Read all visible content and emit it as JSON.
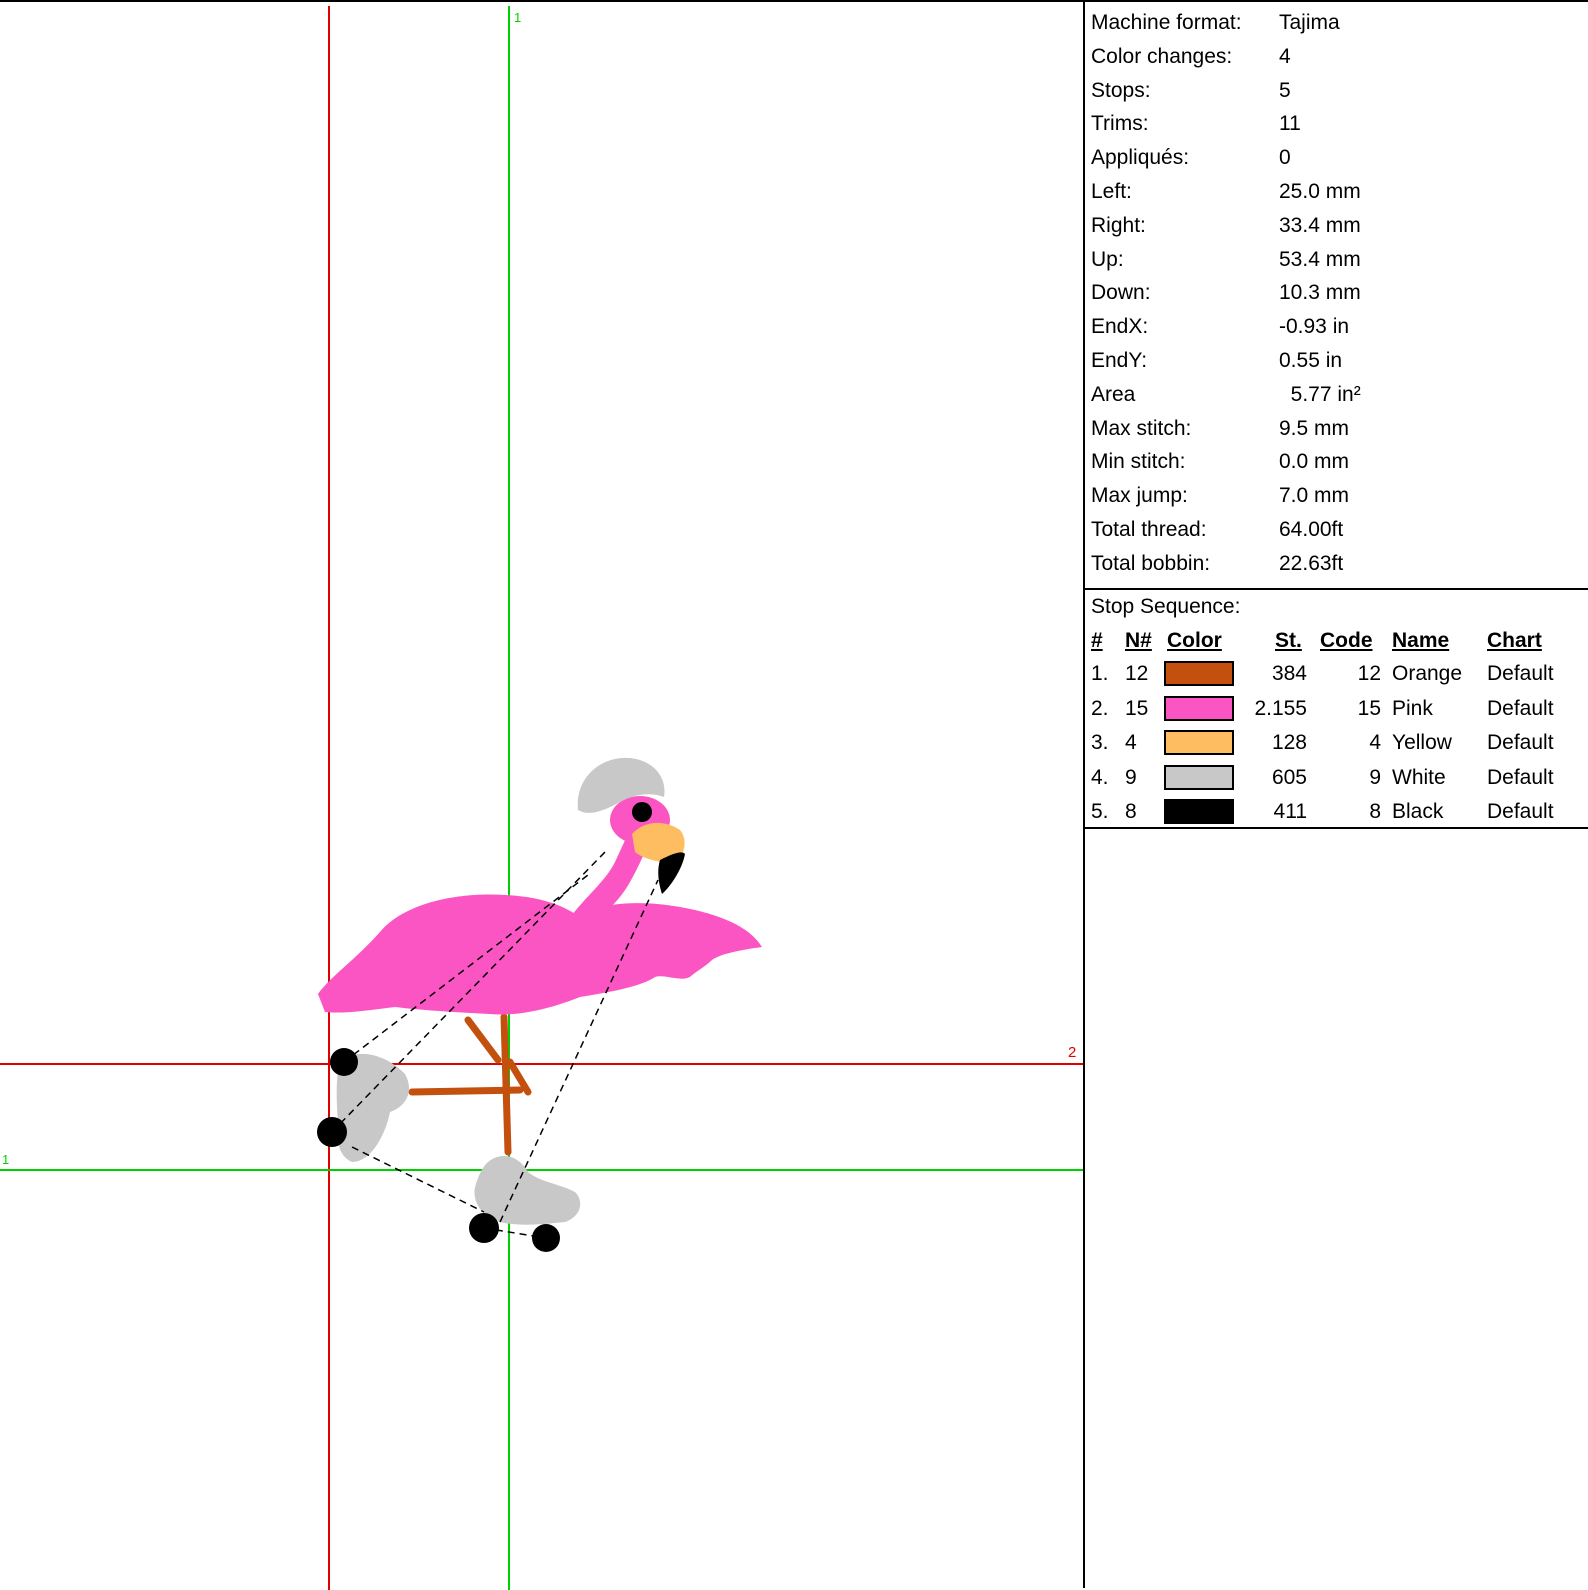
{
  "stats": [
    {
      "label": "Machine format:",
      "value": "Tajima"
    },
    {
      "label": "Color changes:",
      "value": "4"
    },
    {
      "label": "Stops:",
      "value": "5"
    },
    {
      "label": "Trims:",
      "value": "11"
    },
    {
      "label": "Appliqués:",
      "value": "0"
    },
    {
      "label": "Left:",
      "value": "25.0 mm"
    },
    {
      "label": "Right:",
      "value": "33.4 mm"
    },
    {
      "label": "Up:",
      "value": "53.4 mm"
    },
    {
      "label": "Down:",
      "value": "10.3 mm"
    },
    {
      "label": "EndX:",
      "value": "-0.93 in"
    },
    {
      "label": "EndY:",
      "value": "0.55 in"
    },
    {
      "label": "Area",
      "value": "  5.77 in²"
    },
    {
      "label": "Max stitch:",
      "value": "9.5 mm"
    },
    {
      "label": "Min stitch:",
      "value": "0.0 mm"
    },
    {
      "label": "Max jump:",
      "value": "7.0 mm"
    },
    {
      "label": "Total thread:",
      "value": "64.00ft"
    },
    {
      "label": "Total bobbin:",
      "value": "22.63ft"
    }
  ],
  "stop_sequence": {
    "title": "Stop Sequence:",
    "headers": {
      "num": "#",
      "needle": "N#",
      "color": "Color",
      "stitches": "St.",
      "code": "Code",
      "name": "Name",
      "chart": "Chart"
    },
    "rows": [
      {
        "num": "1.",
        "needle": "12",
        "color": "#c4500e",
        "stitches": "384",
        "code": "12",
        "name": "Orange",
        "chart": "Default"
      },
      {
        "num": "2.",
        "needle": "15",
        "color": "#fb55c3",
        "stitches": "2.155",
        "code": "15",
        "name": "Pink",
        "chart": "Default"
      },
      {
        "num": "3.",
        "needle": "4",
        "color": "#fdbd60",
        "stitches": "128",
        "code": "4",
        "name": "Yellow",
        "chart": "Default"
      },
      {
        "num": "4.",
        "needle": "9",
        "color": "#c8c8c8",
        "stitches": "605",
        "code": "9",
        "name": "White",
        "chart": "Default"
      },
      {
        "num": "5.",
        "needle": "8",
        "color": "#000000",
        "stitches": "411",
        "code": "8",
        "name": "Black",
        "chart": "Default"
      }
    ]
  },
  "guides": {
    "vertical_green_label": "1",
    "horizontal_green_label": "1",
    "horizontal_red_label": "2",
    "red_color": "#e00000",
    "green_color": "#00d000"
  }
}
